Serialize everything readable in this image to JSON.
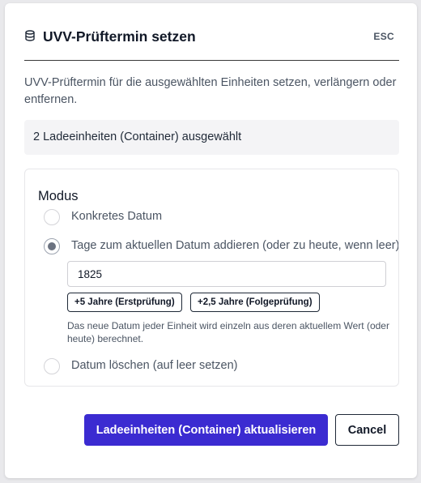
{
  "dialog": {
    "icon": "database-icon",
    "title": "UVV-Prüftermin setzen",
    "esc_label": "ESC",
    "description": "UVV-Prüftermin für die ausgewählten Einheiten setzen, verlängern oder entfernen.",
    "selection_text": "2 Ladeeinheiten (Container) ausgewählt"
  },
  "mode": {
    "title": "Modus",
    "options": [
      {
        "label": "Konkretes Datum",
        "checked": false
      },
      {
        "label": "Tage zum aktuellen Datum addieren (oder zu heute, wenn leer)",
        "checked": true
      },
      {
        "label": "Datum löschen (auf leer setzen)",
        "checked": false
      }
    ],
    "days_value": "1825",
    "chips": [
      {
        "label": "+5 Jahre (Erstprüfung)"
      },
      {
        "label": "+2,5 Jahre (Folgeprüfung)"
      }
    ],
    "hint": "Das neue Datum jeder Einheit wird einzeln aus deren aktuellem Wert (oder heute) berechnet."
  },
  "footer": {
    "submit_label": "Ladeeinheiten (Container) aktualisieren",
    "cancel_label": "Cancel"
  },
  "colors": {
    "primary": "#3b2bd1",
    "panel_bg": "#f4f4f6",
    "text_muted": "#4b5563"
  }
}
